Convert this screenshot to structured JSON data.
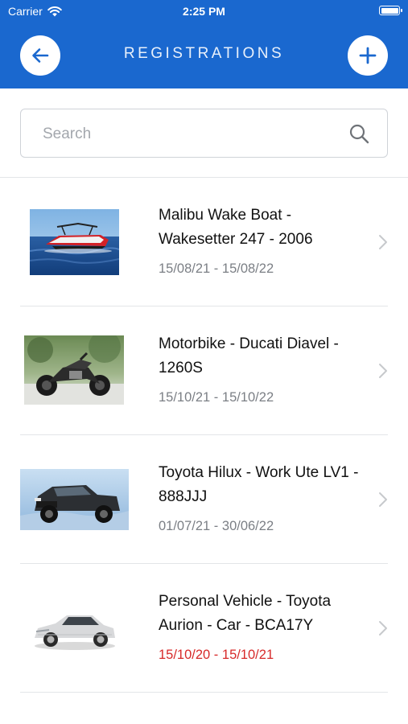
{
  "status_bar": {
    "carrier": "Carrier",
    "time": "2:25 PM"
  },
  "header": {
    "title": "REGISTRATIONS",
    "back_icon": "arrow-left-icon",
    "add_icon": "plus-icon"
  },
  "search": {
    "placeholder": "Search",
    "value": "",
    "icon": "search-icon"
  },
  "registrations": [
    {
      "title": "Malibu Wake Boat - Wakesetter 247 - 2006",
      "dates": "15/08/21 - 15/08/22",
      "expired": false,
      "thumbnail": "wake-boat-photo"
    },
    {
      "title": "Motorbike - Ducati Diavel - 1260S",
      "dates": "15/10/21 - 15/10/22",
      "expired": false,
      "thumbnail": "motorbike-photo"
    },
    {
      "title": "Toyota Hilux - Work Ute LV1 - 888JJJ",
      "dates": "01/07/21 - 30/06/22",
      "expired": false,
      "thumbnail": "ute-photo"
    },
    {
      "title": "Personal Vehicle - Toyota Aurion - Car - BCA17Y",
      "dates": "15/10/20 - 15/10/21",
      "expired": true,
      "thumbnail": "sedan-photo"
    }
  ],
  "colors": {
    "header": "#1a68cf",
    "expired_dates": "#d72a2a",
    "dates": "#7b7f85"
  }
}
